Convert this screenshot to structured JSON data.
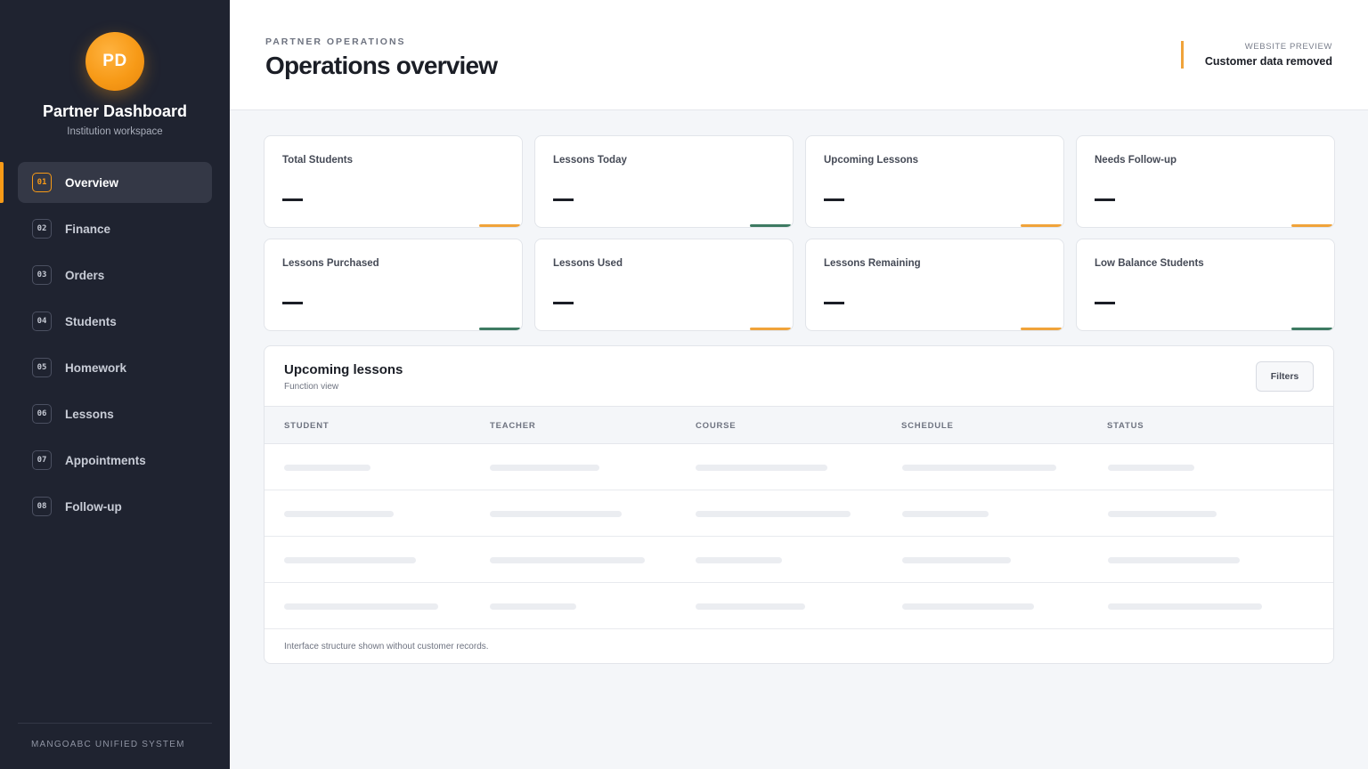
{
  "sidebar": {
    "avatar_initials": "PD",
    "title": "Partner Dashboard",
    "subtitle": "Institution workspace",
    "items": [
      {
        "num": "01",
        "label": "Overview",
        "active": true
      },
      {
        "num": "02",
        "label": "Finance"
      },
      {
        "num": "03",
        "label": "Orders"
      },
      {
        "num": "04",
        "label": "Students"
      },
      {
        "num": "05",
        "label": "Homework"
      },
      {
        "num": "06",
        "label": "Lessons"
      },
      {
        "num": "07",
        "label": "Appointments"
      },
      {
        "num": "08",
        "label": "Follow-up"
      }
    ],
    "footer": "MANGOABC UNIFIED SYSTEM"
  },
  "header": {
    "eyebrow": "PARTNER OPERATIONS",
    "title": "Operations overview",
    "preview_label": "WEBSITE PREVIEW",
    "preview_value": "Customer data removed"
  },
  "stats": [
    {
      "label": "Total Students",
      "value": "—",
      "accent": "#f0a33a"
    },
    {
      "label": "Lessons Today",
      "value": "—",
      "accent": "#3d7a62"
    },
    {
      "label": "Upcoming Lessons",
      "value": "—",
      "accent": "#f0a33a"
    },
    {
      "label": "Needs Follow-up",
      "value": "—",
      "accent": "#f0a33a"
    },
    {
      "label": "Lessons Purchased",
      "value": "—",
      "accent": "#3d7a62"
    },
    {
      "label": "Lessons Used",
      "value": "—",
      "accent": "#f0a33a"
    },
    {
      "label": "Lessons Remaining",
      "value": "—",
      "accent": "#f0a33a"
    },
    {
      "label": "Low Balance Students",
      "value": "—",
      "accent": "#3d7a62"
    }
  ],
  "panel": {
    "title": "Upcoming lessons",
    "subtitle": "Function view",
    "filters_label": "Filters",
    "columns": [
      "STUDENT",
      "TEACHER",
      "COURSE",
      "SCHEDULE",
      "STATUS"
    ],
    "footer": "Interface structure shown without customer records."
  },
  "colors": {
    "accent_orange": "#f79a17",
    "accent_green": "#3d7a62",
    "sidebar_bg": "#1f2330"
  }
}
